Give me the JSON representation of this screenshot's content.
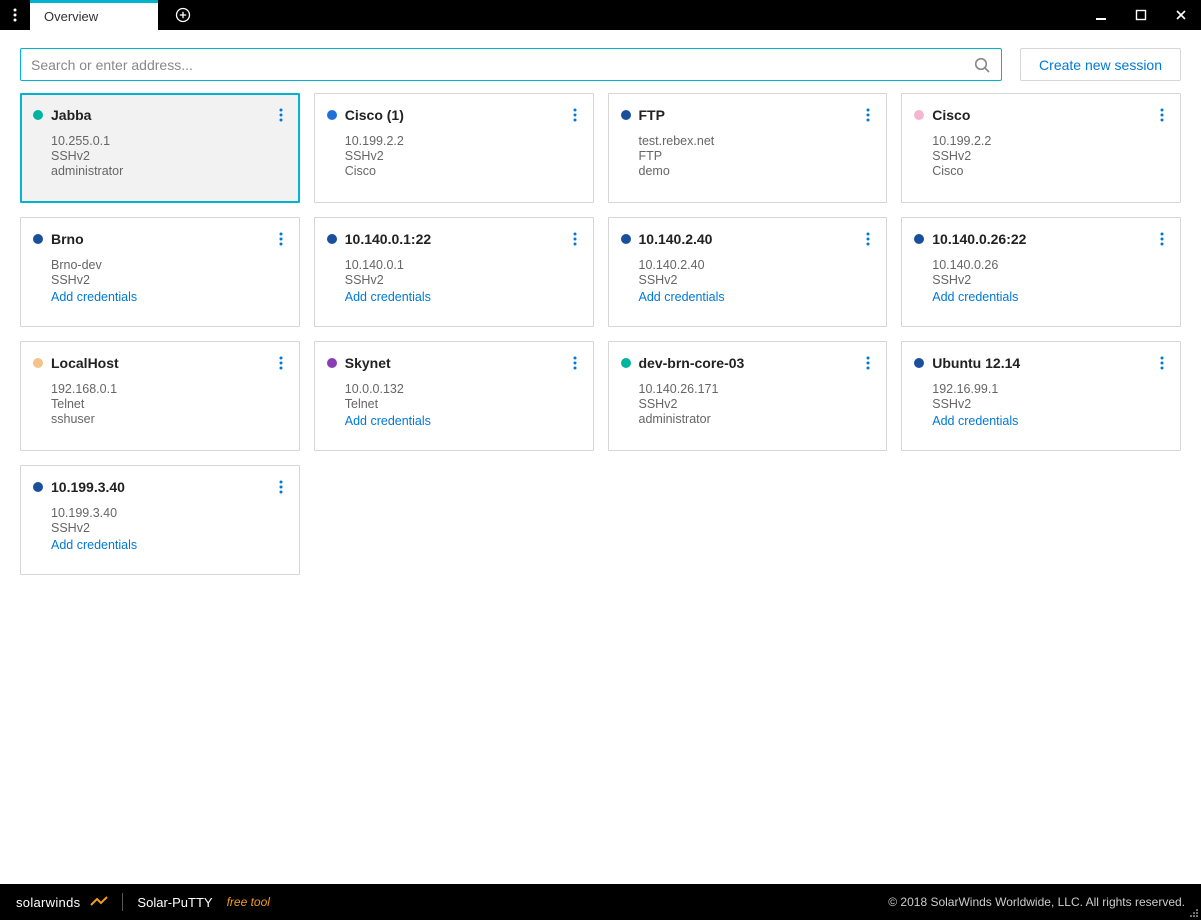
{
  "tab_title": "Overview",
  "search": {
    "placeholder": "Search or enter address..."
  },
  "buttons": {
    "new_session": "Create new session"
  },
  "labels": {
    "add_credentials": "Add credentials"
  },
  "colors": {
    "teal": "#00b4a0",
    "blue": "#2070d8",
    "navy": "#1a4f9c",
    "darkblue": "#1a4f9c",
    "orange_tan": "#f5c38b",
    "purple": "#8a3eb6",
    "pink": "#f5b6cf"
  },
  "footer": {
    "brand": "solarwinds",
    "product": "Solar-PuTTY",
    "tag": "free tool",
    "copyright": "© 2018 SolarWinds Worldwide, LLC. All rights reserved."
  },
  "sessions": [
    {
      "name": "Jabba",
      "host": "10.255.0.1",
      "proto": "SSHv2",
      "user": "administrator",
      "dot": "#00b4a0",
      "selected": true
    },
    {
      "name": "Cisco (1)",
      "host": "10.199.2.2",
      "proto": "SSHv2",
      "user": "Cisco",
      "dot": "#2070d8"
    },
    {
      "name": "FTP",
      "host": "test.rebex.net",
      "proto": "FTP",
      "user": "demo",
      "dot": "#1a4f9c"
    },
    {
      "name": "Cisco",
      "host": "10.199.2.2",
      "proto": "SSHv2",
      "user": "Cisco",
      "dot": "#f5b6cf"
    },
    {
      "name": "Brno",
      "host": "Brno-dev",
      "proto": "SSHv2",
      "add_credentials": true,
      "dot": "#1a4f9c"
    },
    {
      "name": "10.140.0.1:22",
      "host": "10.140.0.1",
      "proto": "SSHv2",
      "add_credentials": true,
      "dot": "#1a4f9c"
    },
    {
      "name": "10.140.2.40",
      "host": "10.140.2.40",
      "proto": "SSHv2",
      "add_credentials": true,
      "dot": "#1a4f9c"
    },
    {
      "name": "10.140.0.26:22",
      "host": "10.140.0.26",
      "proto": "SSHv2",
      "add_credentials": true,
      "dot": "#1a4f9c"
    },
    {
      "name": "LocalHost",
      "host": "192.168.0.1",
      "proto": "Telnet",
      "user": "sshuser",
      "dot": "#f5c38b"
    },
    {
      "name": "Skynet",
      "host": "10.0.0.132",
      "proto": "Telnet",
      "add_credentials": true,
      "dot": "#8a3eb6"
    },
    {
      "name": "dev-brn-core-03",
      "host": "10.140.26.171",
      "proto": "SSHv2",
      "user": "administrator",
      "dot": "#00b4a0"
    },
    {
      "name": "Ubuntu 12.14",
      "host": "192.16.99.1",
      "proto": "SSHv2",
      "add_credentials": true,
      "dot": "#1a4f9c"
    },
    {
      "name": "10.199.3.40",
      "host": "10.199.3.40",
      "proto": "SSHv2",
      "add_credentials": true,
      "dot": "#1a4f9c"
    }
  ]
}
